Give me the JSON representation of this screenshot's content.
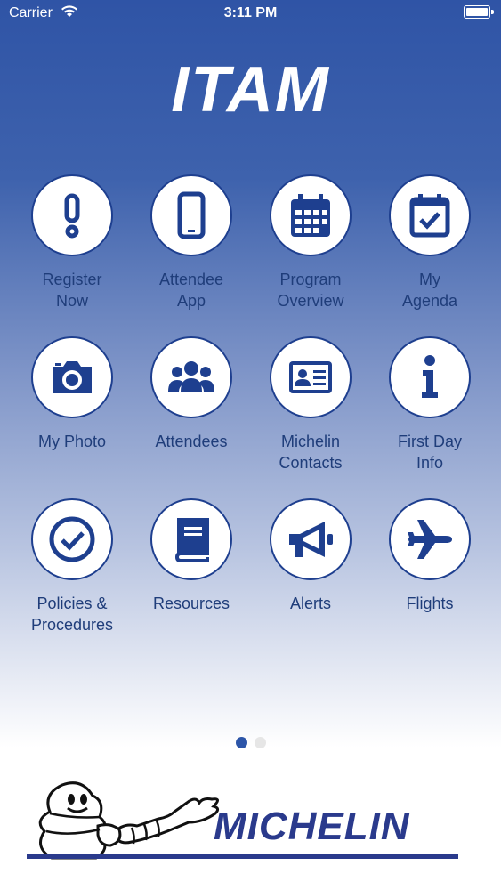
{
  "status_bar": {
    "carrier": "Carrier",
    "time": "3:11 PM"
  },
  "header": {
    "logo_text": "ITAM"
  },
  "tiles": [
    {
      "label": "Register\nNow",
      "icon": "exclamation-icon"
    },
    {
      "label": "Attendee\nApp",
      "icon": "smartphone-icon"
    },
    {
      "label": "Program\nOverview",
      "icon": "calendar-icon"
    },
    {
      "label": "My\nAgenda",
      "icon": "calendar-check-icon"
    },
    {
      "label": "My Photo",
      "icon": "camera-icon"
    },
    {
      "label": "Attendees",
      "icon": "people-icon"
    },
    {
      "label": "Michelin\nContacts",
      "icon": "id-card-icon"
    },
    {
      "label": "First Day\nInfo",
      "icon": "info-icon"
    },
    {
      "label": "Policies &\nProcedures",
      "icon": "check-circle-icon"
    },
    {
      "label": "Resources",
      "icon": "book-icon"
    },
    {
      "label": "Alerts",
      "icon": "megaphone-icon"
    },
    {
      "label": "Flights",
      "icon": "airplane-icon"
    }
  ],
  "pagination": {
    "current": 1,
    "total": 2
  },
  "footer": {
    "brand_text": "MICHELIN"
  },
  "colors": {
    "primary": "#2f54a6",
    "icon": "#1e3f8f",
    "label": "#1f3d7a",
    "brand": "#2a3a8c"
  }
}
